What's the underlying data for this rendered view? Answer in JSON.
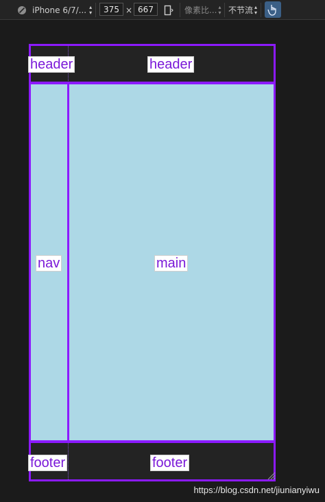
{
  "toolbar": {
    "device": "iPhone 6/7/...",
    "width": "375",
    "times": "×",
    "height": "667",
    "pixel_ratio": "像素比...",
    "throttle": "不节流"
  },
  "grid": {
    "header_left": "header",
    "header_right": "header",
    "nav": "nav",
    "main": "main",
    "footer_left": "footer",
    "footer_right": "footer"
  },
  "watermark": "https://blog.csdn.net/jiunianyiwu",
  "colors": {
    "grid_border": "#8c1aff",
    "content_bg": "#add8e6",
    "dark_bg": "#232323"
  }
}
